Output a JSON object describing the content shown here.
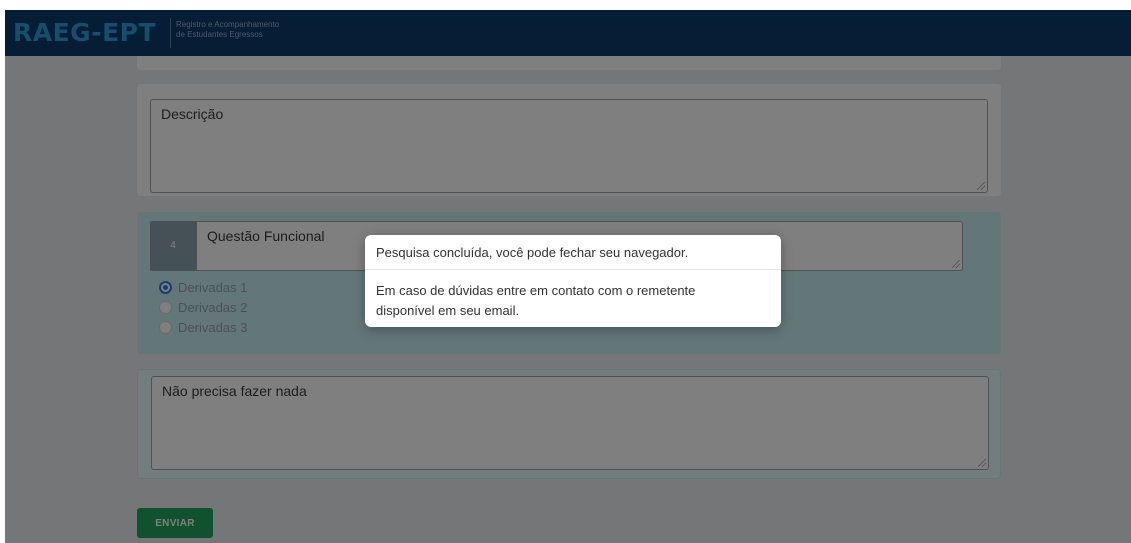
{
  "app": {
    "logo_text": "RAEG-EPT",
    "subtitle_line1": "Registro e Acompanhamento",
    "subtitle_line2": "de Estudantes Egressos"
  },
  "description_field": {
    "placeholder": "Descrição"
  },
  "question": {
    "number": "4",
    "title": "Questão Funcional",
    "options": [
      {
        "label": "Derivadas 1",
        "checked": true
      },
      {
        "label": "Derivadas 2",
        "checked": false
      },
      {
        "label": "Derivadas 3",
        "checked": false
      }
    ]
  },
  "answer_field": {
    "value": "Não precisa fazer nada"
  },
  "submit_button": {
    "label": "ENVIAR"
  },
  "modal": {
    "title": "Pesquisa concluída, você pode fechar seu navegador.",
    "body_line1": "Em caso de dúvidas entre em contato com o remetente",
    "body_line2": "disponível em seu email."
  },
  "colors": {
    "navbar": "#0b3b6a",
    "logo": "#2d9cdb",
    "submit": "#1fa55b",
    "question_card": "#c8eef0",
    "radio_checked": "#2b7de9"
  }
}
